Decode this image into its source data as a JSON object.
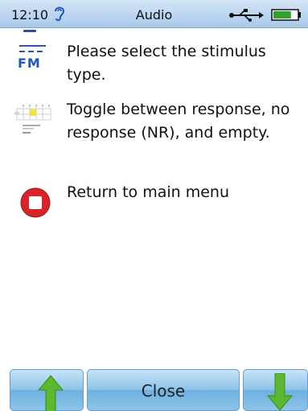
{
  "status_bar": {
    "time": "12:10",
    "title": "Audio",
    "icons": [
      "ear-icon",
      "usb-icon",
      "battery-icon"
    ],
    "battery_level": 0.75
  },
  "items": [
    {
      "icon": "fm-icon",
      "icon_label": "FM",
      "text": "Please select the stimulus type."
    },
    {
      "icon": "grid-icon",
      "text": "Toggle between response, no response (NR), and empty."
    },
    {
      "icon": "stop-icon",
      "text": "Return to main menu"
    }
  ],
  "bottom_bar": {
    "up_icon": "arrow-up-icon",
    "close_label": "Close",
    "down_icon": "arrow-down-icon"
  },
  "colors": {
    "status_bar": "#a7c8ea",
    "button": "#8ec3ea",
    "arrow": "#5cb82e",
    "stop": "#d8232a",
    "fm": "#1f56c0"
  }
}
